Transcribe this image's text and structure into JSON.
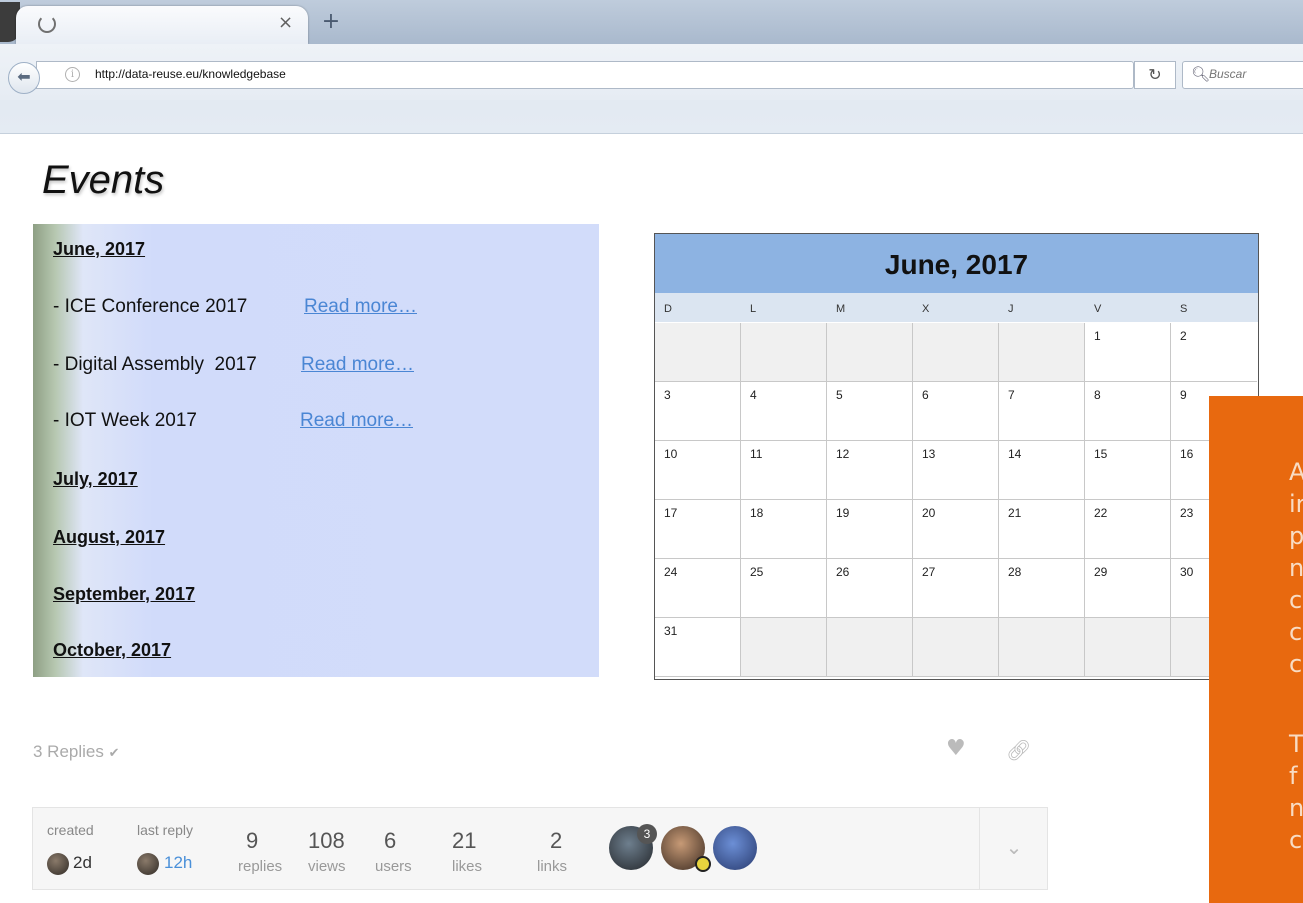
{
  "browser": {
    "tab": {
      "close_glyph": "×"
    },
    "new_tab_glyph": "+",
    "url": "http://data-reuse.eu/knowledgebase",
    "search_placeholder": "Buscar",
    "icons": [
      "page-loading-icon",
      "back-arrow-icon",
      "info-icon",
      "reload-icon",
      "search-icon"
    ]
  },
  "page": {
    "title": "Events",
    "events_panel": {
      "months": [
        {
          "label": "June, 2017"
        },
        {
          "label": "July, 2017"
        },
        {
          "label": "August, 2017"
        },
        {
          "label": "September, 2017"
        },
        {
          "label": "October, 2017"
        }
      ],
      "events": [
        {
          "name": "- ICE Conference 2017",
          "link": "Read more…"
        },
        {
          "name": "- Digital Assembly  2017",
          "link": "Read more…"
        },
        {
          "name": "- IOT Week 2017",
          "link": "Read more…"
        }
      ]
    },
    "calendar": {
      "title": "June, 2017",
      "day_names": [
        "D",
        "L",
        "M",
        "X",
        "J",
        "V",
        "S"
      ],
      "weeks": [
        [
          "",
          "",
          "",
          "",
          "",
          "1",
          "2"
        ],
        [
          "3",
          "4",
          "5",
          "6",
          "7",
          "8",
          "9"
        ],
        [
          "10",
          "11",
          "12",
          "13",
          "14",
          "15",
          "16"
        ],
        [
          "17",
          "18",
          "19",
          "20",
          "21",
          "22",
          "23"
        ],
        [
          "24",
          "25",
          "26",
          "27",
          "28",
          "29",
          "30"
        ],
        [
          "31",
          "",
          "",
          "",
          "",
          "",
          ""
        ]
      ],
      "colors": {
        "header": "#8db3e2",
        "day_names_bg": "#dbe5f1",
        "empty_cell": "#f0f0f0"
      }
    },
    "orange_overlay": {
      "color": "#e8690f",
      "lines": [
        "A",
        "ir",
        "p",
        "n",
        "c",
        "c",
        "c",
        "",
        "T",
        "f",
        "n",
        "c"
      ]
    }
  },
  "topic": {
    "replies_toggle": "3 Replies",
    "created_label": "created",
    "created_value": "2d",
    "last_reply_label": "last reply",
    "last_reply_value": "12h",
    "stats": [
      {
        "number": "9",
        "label": "replies"
      },
      {
        "number": "108",
        "label": "views"
      },
      {
        "number": "6",
        "label": "users"
      },
      {
        "number": "21",
        "label": "likes"
      },
      {
        "number": "2",
        "label": "links"
      }
    ],
    "avatar_badge": "3",
    "colors": {
      "last_reply": "#4a90d9"
    }
  }
}
